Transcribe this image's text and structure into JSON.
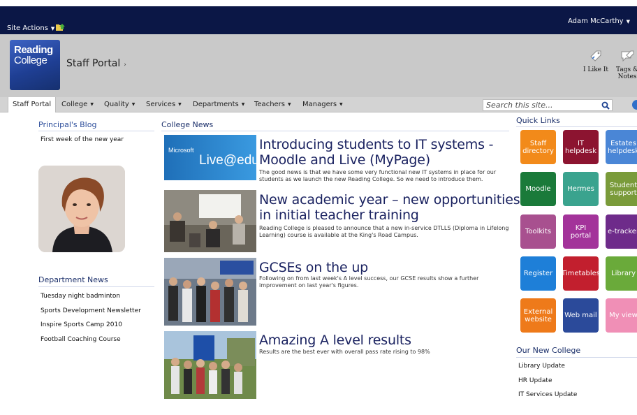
{
  "topbar": {
    "site_actions": "Site Actions",
    "user": "Adam McCarthy"
  },
  "header": {
    "logo_line1": "Reading",
    "logo_line2": "College",
    "title": "Staff Portal",
    "like_label": "I Like It",
    "tags_label_1": "Tags &",
    "tags_label_2": "Notes"
  },
  "nav": {
    "items": [
      "Staff Portal",
      "College",
      "Quality",
      "Services",
      "Departments",
      "Teachers",
      "Managers"
    ],
    "search_placeholder": "Search this site..."
  },
  "blog": {
    "title": "Principal's Blog",
    "posts": [
      "First week of the new year"
    ]
  },
  "dept_news": {
    "title": "Department News",
    "items": [
      "Tuesday night badminton",
      "Sports Development Newsletter",
      "Inspire Sports Camp 2010",
      "Football Coaching Course"
    ]
  },
  "college_news": {
    "title": "College News",
    "live_logo_small": "Microsoft",
    "live_logo_big": "Live@edu",
    "articles": [
      {
        "title_1": "Introducing students to IT systems -",
        "title_2": "Moodle and Live (MyPage)",
        "body_1": "The good news is that we have some very functional new IT systems in place for our",
        "body_2": "students as we launch the new Reading College. So we need to introduce them."
      },
      {
        "title_1": "New academic year – new opportunities",
        "title_2": "in initial teacher training",
        "body_1": "Reading College is pleased to announce that a new in-service DTLLS (Diploma in Lifelong",
        "body_2": "Learning) course is available at the King's Road Campus."
      },
      {
        "title_1": "GCSEs on the up",
        "body_1": "Following on from last week's A level success, our GCSE results show a further",
        "body_2": "improvement on last year's figures."
      },
      {
        "title_1": "Amazing A level results",
        "body_1": "Results are the best ever with overall pass rate rising to 98%"
      }
    ]
  },
  "quick_links": {
    "title": "Quick Links",
    "tiles": [
      {
        "label_1": "Staff",
        "label_2": "directory",
        "color": "#f28a1a"
      },
      {
        "label_1": "IT",
        "label_2": "helpdesk",
        "color": "#8c1430"
      },
      {
        "label_1": "Estates",
        "label_2": "helpdesk",
        "color": "#4a86d6"
      },
      {
        "label_1": "Moodle",
        "label_2": "",
        "color": "#1a7a3a"
      },
      {
        "label_1": "Hermes",
        "label_2": "",
        "color": "#3aa38e"
      },
      {
        "label_1": "Student",
        "label_2": "support",
        "color": "#7a9b3a"
      },
      {
        "label_1": "Toolkits",
        "label_2": "",
        "color": "#a8508f"
      },
      {
        "label_1": "KPI",
        "label_2": "portal",
        "color": "#a3339a"
      },
      {
        "label_1": "e-tracker",
        "label_2": "",
        "color": "#6e2b8a"
      },
      {
        "label_1": "Register",
        "label_2": "",
        "color": "#1e7fd8"
      },
      {
        "label_1": "Timetables",
        "label_2": "",
        "color": "#c21f2e"
      },
      {
        "label_1": "Library",
        "label_2": "",
        "color": "#6aaa3a"
      },
      {
        "label_1": "External",
        "label_2": "website",
        "color": "#ee7a1a"
      },
      {
        "label_1": "Web mail",
        "label_2": "",
        "color": "#2b4a9a"
      },
      {
        "label_1": "My view",
        "label_2": "",
        "color": "#f08fb6"
      }
    ]
  },
  "new_college": {
    "title": "Our New College",
    "items": [
      "Library Update",
      "HR Update",
      "IT Services Update"
    ]
  }
}
